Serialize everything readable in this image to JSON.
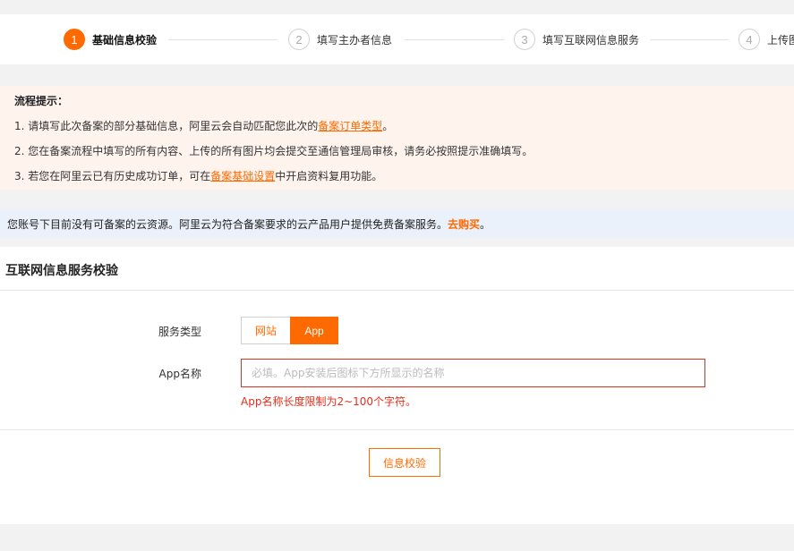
{
  "steps": [
    {
      "number": "1",
      "label": "基础信息校验",
      "active": true
    },
    {
      "number": "2",
      "label": "填写主办者信息",
      "active": false
    },
    {
      "number": "3",
      "label": "填写互联网信息服务",
      "active": false
    },
    {
      "number": "4",
      "label": "上传图",
      "active": false
    }
  ],
  "tips": {
    "title": "流程提示：",
    "line1_prefix": "1. 请填写此次备案的部分基础信息，阿里云会自动匹配您此次的",
    "line1_link": "备案订单类型",
    "line1_suffix": "。",
    "line2": "2. 您在备案流程中填写的所有内容、上传的所有图片均会提交至通信管理局审核，请务必按照提示准确填写。",
    "line3_prefix": "3. 若您在阿里云已有历史成功订单，可在",
    "line3_link": "备案基础设置",
    "line3_suffix": "中开启资料复用功能。"
  },
  "notice": {
    "text": "您账号下目前没有可备案的云资源。阿里云为符合备案要求的云产品用户提供免费备案服务。",
    "link": "去购买",
    "suffix": "。"
  },
  "panel": {
    "title": "互联网信息服务校验",
    "service_type_label": "服务类型",
    "service_options": [
      "网站",
      "App"
    ],
    "service_selected": "App",
    "app_name_label": "App名称",
    "app_name_value": "",
    "app_name_placeholder": "必填。App安装后图标下方所显示的名称",
    "error": "App名称长度限制为2~100个字符。",
    "verify_button": "信息校验"
  },
  "colors": {
    "accent": "#ff6a00",
    "error": "#e0301e",
    "tips_bg": "#fff3ee",
    "notice_bg": "#eaf1fb"
  }
}
